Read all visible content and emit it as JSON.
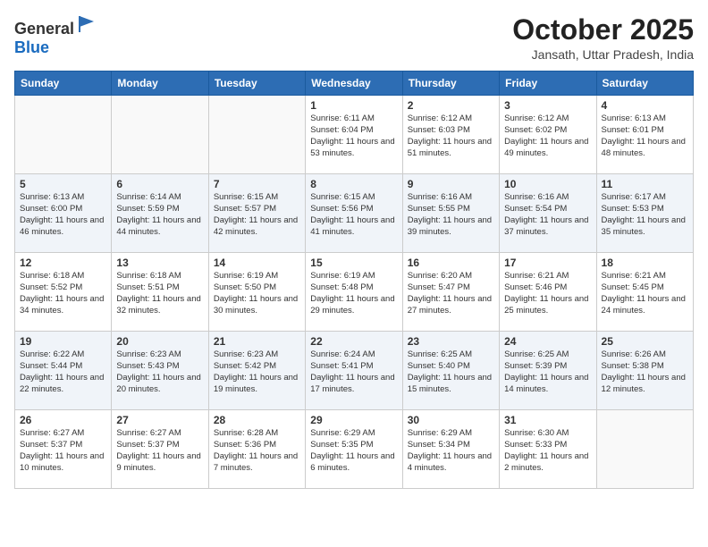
{
  "header": {
    "logo_general": "General",
    "logo_blue": "Blue",
    "month_title": "October 2025",
    "subtitle": "Jansath, Uttar Pradesh, India"
  },
  "weekdays": [
    "Sunday",
    "Monday",
    "Tuesday",
    "Wednesday",
    "Thursday",
    "Friday",
    "Saturday"
  ],
  "weeks": [
    [
      {
        "day": "",
        "text": ""
      },
      {
        "day": "",
        "text": ""
      },
      {
        "day": "",
        "text": ""
      },
      {
        "day": "1",
        "text": "Sunrise: 6:11 AM\nSunset: 6:04 PM\nDaylight: 11 hours and 53 minutes."
      },
      {
        "day": "2",
        "text": "Sunrise: 6:12 AM\nSunset: 6:03 PM\nDaylight: 11 hours and 51 minutes."
      },
      {
        "day": "3",
        "text": "Sunrise: 6:12 AM\nSunset: 6:02 PM\nDaylight: 11 hours and 49 minutes."
      },
      {
        "day": "4",
        "text": "Sunrise: 6:13 AM\nSunset: 6:01 PM\nDaylight: 11 hours and 48 minutes."
      }
    ],
    [
      {
        "day": "5",
        "text": "Sunrise: 6:13 AM\nSunset: 6:00 PM\nDaylight: 11 hours and 46 minutes."
      },
      {
        "day": "6",
        "text": "Sunrise: 6:14 AM\nSunset: 5:59 PM\nDaylight: 11 hours and 44 minutes."
      },
      {
        "day": "7",
        "text": "Sunrise: 6:15 AM\nSunset: 5:57 PM\nDaylight: 11 hours and 42 minutes."
      },
      {
        "day": "8",
        "text": "Sunrise: 6:15 AM\nSunset: 5:56 PM\nDaylight: 11 hours and 41 minutes."
      },
      {
        "day": "9",
        "text": "Sunrise: 6:16 AM\nSunset: 5:55 PM\nDaylight: 11 hours and 39 minutes."
      },
      {
        "day": "10",
        "text": "Sunrise: 6:16 AM\nSunset: 5:54 PM\nDaylight: 11 hours and 37 minutes."
      },
      {
        "day": "11",
        "text": "Sunrise: 6:17 AM\nSunset: 5:53 PM\nDaylight: 11 hours and 35 minutes."
      }
    ],
    [
      {
        "day": "12",
        "text": "Sunrise: 6:18 AM\nSunset: 5:52 PM\nDaylight: 11 hours and 34 minutes."
      },
      {
        "day": "13",
        "text": "Sunrise: 6:18 AM\nSunset: 5:51 PM\nDaylight: 11 hours and 32 minutes."
      },
      {
        "day": "14",
        "text": "Sunrise: 6:19 AM\nSunset: 5:50 PM\nDaylight: 11 hours and 30 minutes."
      },
      {
        "day": "15",
        "text": "Sunrise: 6:19 AM\nSunset: 5:48 PM\nDaylight: 11 hours and 29 minutes."
      },
      {
        "day": "16",
        "text": "Sunrise: 6:20 AM\nSunset: 5:47 PM\nDaylight: 11 hours and 27 minutes."
      },
      {
        "day": "17",
        "text": "Sunrise: 6:21 AM\nSunset: 5:46 PM\nDaylight: 11 hours and 25 minutes."
      },
      {
        "day": "18",
        "text": "Sunrise: 6:21 AM\nSunset: 5:45 PM\nDaylight: 11 hours and 24 minutes."
      }
    ],
    [
      {
        "day": "19",
        "text": "Sunrise: 6:22 AM\nSunset: 5:44 PM\nDaylight: 11 hours and 22 minutes."
      },
      {
        "day": "20",
        "text": "Sunrise: 6:23 AM\nSunset: 5:43 PM\nDaylight: 11 hours and 20 minutes."
      },
      {
        "day": "21",
        "text": "Sunrise: 6:23 AM\nSunset: 5:42 PM\nDaylight: 11 hours and 19 minutes."
      },
      {
        "day": "22",
        "text": "Sunrise: 6:24 AM\nSunset: 5:41 PM\nDaylight: 11 hours and 17 minutes."
      },
      {
        "day": "23",
        "text": "Sunrise: 6:25 AM\nSunset: 5:40 PM\nDaylight: 11 hours and 15 minutes."
      },
      {
        "day": "24",
        "text": "Sunrise: 6:25 AM\nSunset: 5:39 PM\nDaylight: 11 hours and 14 minutes."
      },
      {
        "day": "25",
        "text": "Sunrise: 6:26 AM\nSunset: 5:38 PM\nDaylight: 11 hours and 12 minutes."
      }
    ],
    [
      {
        "day": "26",
        "text": "Sunrise: 6:27 AM\nSunset: 5:37 PM\nDaylight: 11 hours and 10 minutes."
      },
      {
        "day": "27",
        "text": "Sunrise: 6:27 AM\nSunset: 5:37 PM\nDaylight: 11 hours and 9 minutes."
      },
      {
        "day": "28",
        "text": "Sunrise: 6:28 AM\nSunset: 5:36 PM\nDaylight: 11 hours and 7 minutes."
      },
      {
        "day": "29",
        "text": "Sunrise: 6:29 AM\nSunset: 5:35 PM\nDaylight: 11 hours and 6 minutes."
      },
      {
        "day": "30",
        "text": "Sunrise: 6:29 AM\nSunset: 5:34 PM\nDaylight: 11 hours and 4 minutes."
      },
      {
        "day": "31",
        "text": "Sunrise: 6:30 AM\nSunset: 5:33 PM\nDaylight: 11 hours and 2 minutes."
      },
      {
        "day": "",
        "text": ""
      }
    ]
  ]
}
